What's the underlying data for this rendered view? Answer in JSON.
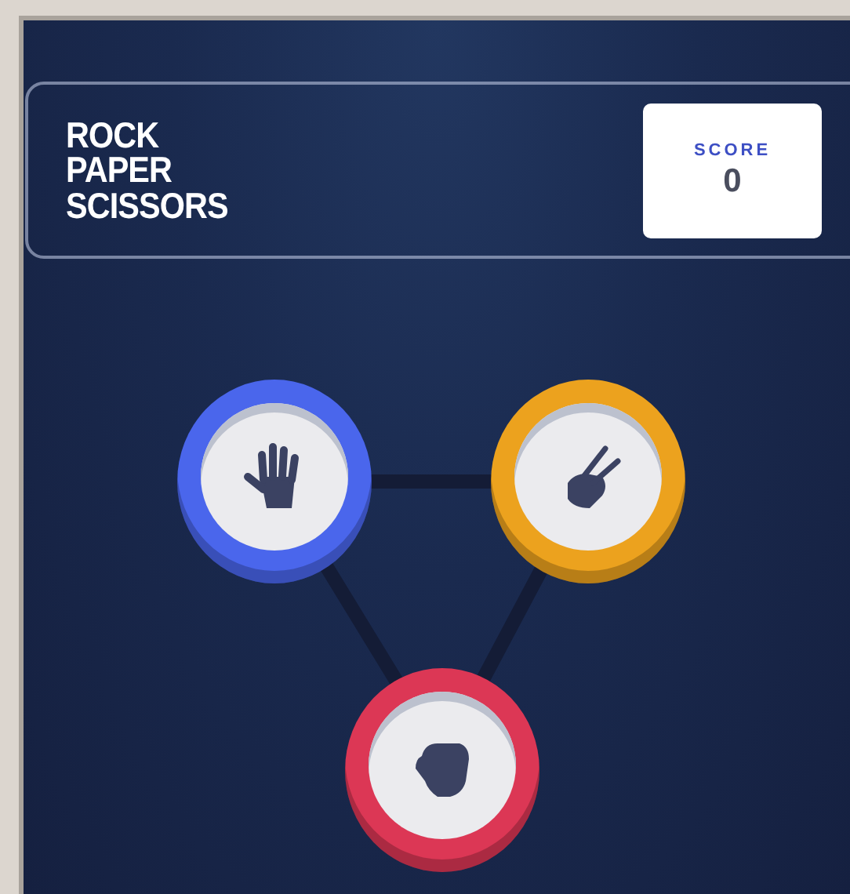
{
  "title_lines": [
    "ROCK",
    "PAPER",
    "SCISSORS"
  ],
  "score": {
    "label": "SCORE",
    "value": "0"
  },
  "choices": [
    {
      "kind": "paper",
      "color": "#4a66ec"
    },
    {
      "kind": "scissors",
      "color": "#eca21e"
    },
    {
      "kind": "rock",
      "color": "#dc3755"
    }
  ]
}
